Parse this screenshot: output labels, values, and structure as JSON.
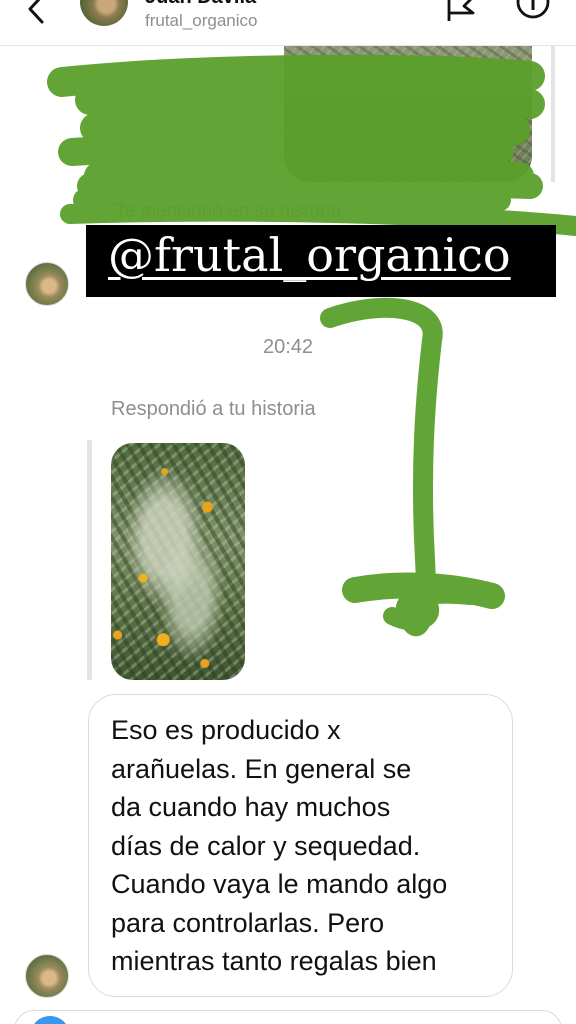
{
  "header": {
    "name": "Juan Dávila",
    "username": "frutal_organico",
    "back_icon": "chevron-left-icon",
    "flag_icon": "flag-icon",
    "info_icon": "info-icon"
  },
  "thread": {
    "mention_caption": "Te mencionó en su historia",
    "mention_text": "@frutal_organico",
    "timestamp": "20:42",
    "reply_caption": "Respondió a tu historia",
    "message": "Eso es producido x\narañuelas.  En general se\nda cuando hay muchos\ndías de calor y sequedad.\nCuando vaya le mando algo\npara controlarlas. Pero\nmientras tanto regalas bien"
  },
  "colors": {
    "accent_blue": "#3897f0",
    "scribble_green": "#5aa02c",
    "secondary_text": "#8e8e8e"
  }
}
